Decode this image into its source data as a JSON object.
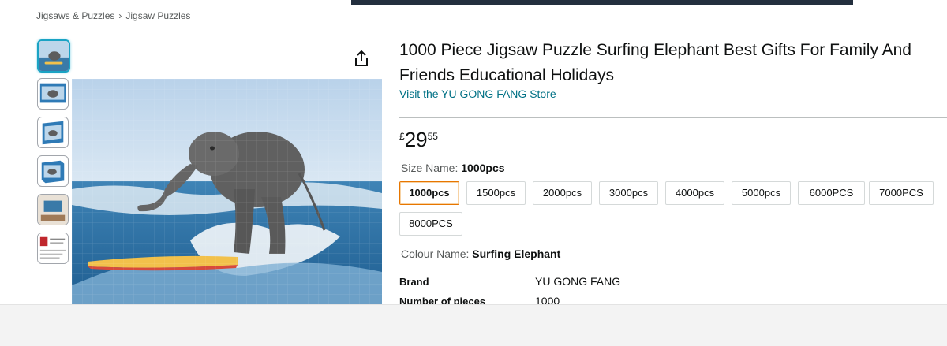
{
  "breadcrumb": [
    "Jigsaws & Puzzles",
    "Jigsaw Puzzles"
  ],
  "breadcrumb_separator": "›",
  "product": {
    "title": "1000 Piece Jigsaw Puzzle Surfing Elephant Best Gifts For Family And Friends Educational Holidays",
    "store_link": "Visit the YU GONG FANG Store",
    "price": {
      "currency": "£",
      "whole": "29",
      "fraction": "55"
    }
  },
  "size": {
    "label": "Size Name:",
    "selected": "1000pcs",
    "options": [
      "1000pcs",
      "1500pcs",
      "2000pcs",
      "3000pcs",
      "4000pcs",
      "5000pcs",
      "6000PCS",
      "7000PCS",
      "8000PCS"
    ]
  },
  "colour": {
    "label": "Colour Name:",
    "selected": "Surfing Elephant"
  },
  "specs": [
    {
      "key": "Brand",
      "value": "YU GONG FANG"
    },
    {
      "key": "Number of pieces",
      "value": "1000"
    }
  ],
  "icons": {
    "share": "share-icon"
  },
  "colors": {
    "link": "#007185",
    "selected_border": "#e77600",
    "thumb_active": "#1aa3c4"
  }
}
